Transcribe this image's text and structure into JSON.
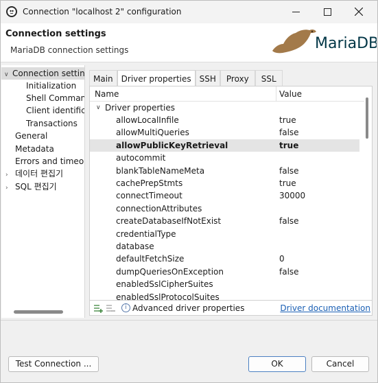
{
  "window": {
    "title": "Connection \"localhost 2\" configuration",
    "minimize": "—",
    "maximize": "☐",
    "close": "✕"
  },
  "header": {
    "title": "Connection settings",
    "subtitle": "MariaDB connection settings",
    "logo_text": "MariaDB"
  },
  "tree": {
    "items": [
      {
        "label": "Connection settings",
        "chevron": "∨"
      },
      {
        "label": "Initialization"
      },
      {
        "label": "Shell Commands"
      },
      {
        "label": "Client identification"
      },
      {
        "label": "Transactions"
      },
      {
        "label": "General"
      },
      {
        "label": "Metadata"
      },
      {
        "label": "Errors and timeouts"
      },
      {
        "label": "데이터 편집기",
        "chevron": "›"
      },
      {
        "label": "SQL 편집기",
        "chevron": "›"
      }
    ]
  },
  "tabs": [
    {
      "label": "Main"
    },
    {
      "label": "Driver properties"
    },
    {
      "label": "SSH"
    },
    {
      "label": "Proxy"
    },
    {
      "label": "SSL"
    }
  ],
  "table": {
    "col_name": "Name",
    "col_value": "Value",
    "group_label": "Driver properties",
    "group_chevron": "∨",
    "rows": [
      {
        "name": "allowLocalInfile",
        "value": "true"
      },
      {
        "name": "allowMultiQueries",
        "value": "false"
      },
      {
        "name": "allowPublicKeyRetrieval",
        "value": "true"
      },
      {
        "name": "autocommit",
        "value": ""
      },
      {
        "name": "blankTableNameMeta",
        "value": "false"
      },
      {
        "name": "cachePrepStmts",
        "value": "true"
      },
      {
        "name": "connectTimeout",
        "value": "30000"
      },
      {
        "name": "connectionAttributes",
        "value": ""
      },
      {
        "name": "createDatabaseIfNotExist",
        "value": "false"
      },
      {
        "name": "credentialType",
        "value": ""
      },
      {
        "name": "database",
        "value": ""
      },
      {
        "name": "defaultFetchSize",
        "value": "0"
      },
      {
        "name": "dumpQueriesOnException",
        "value": "false"
      },
      {
        "name": "enabledSslCipherSuites",
        "value": ""
      },
      {
        "name": "enabledSslProtocolSuites",
        "value": ""
      }
    ]
  },
  "footer": {
    "advanced_label": "Advanced driver properties",
    "info_glyph": "i",
    "driver_doc_link": "Driver documentation"
  },
  "buttons": {
    "test_connection": "Test Connection ...",
    "ok": "OK",
    "cancel": "Cancel"
  }
}
